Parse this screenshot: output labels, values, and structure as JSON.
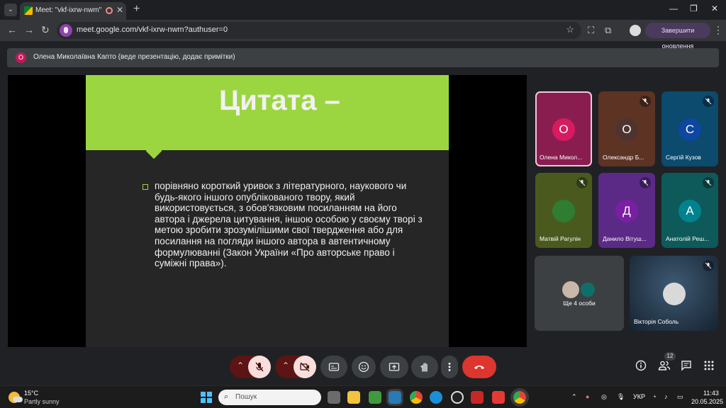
{
  "browser": {
    "tab_title": "Meet: \"vkf-ixrw-nwm\"",
    "tab_close": "✕",
    "new_tab": "+",
    "url": "meet.google.com/vkf-ixrw-nwm?authuser=0",
    "update_button": "Завершити оновлення"
  },
  "meet": {
    "presenter_initial": "О",
    "presenter_banner": "Олена Миколаївна Капто (веде презентацію, додає примітки)",
    "slide": {
      "title": "Цитата –",
      "body": "порівняно короткий уривок з літературного, наукового чи будь-якого іншого опублікованого твору, який використовується, з обов'язковим посиланням на його автора і джерела цитування, іншою особою у своєму творі з метою зробити зрозумілішими свої твердження або для посилання на погляди іншого автора в автентичному формулюванні (Закон України «Про авторське право і суміжні права»)."
    },
    "participants": [
      {
        "initial": "О",
        "name": "Олена Микол...",
        "bg": "#8a1d4f",
        "avatar_color": "#d81b60",
        "muted": false
      },
      {
        "initial": "О",
        "name": "Олександр Б...",
        "bg": "#5d3324",
        "avatar_color": "#4e342e",
        "muted": true
      },
      {
        "initial": "С",
        "name": "Сергій Кузов",
        "bg": "#0c4a6e",
        "avatar_color": "#0d47a1",
        "muted": true
      },
      {
        "initial": "",
        "name": "Матвій Рагулін",
        "bg": "#4a5a1f",
        "avatar_color": "#2e7d32",
        "muted": true
      },
      {
        "initial": "Д",
        "name": "Данило Вітуш...",
        "bg": "#5b2a86",
        "avatar_color": "#7b1fa2",
        "muted": true
      },
      {
        "initial": "А",
        "name": "Анатолій Реш...",
        "bg": "#0e5a5a",
        "avatar_color": "#00838f",
        "muted": true
      }
    ],
    "others_label": "Ще 4 особи",
    "pinned_name": "Вікторія Соболь",
    "participant_count": "12"
  },
  "taskbar": {
    "temperature": "15°C",
    "weather": "Partly sunny",
    "search_placeholder": "Пошук",
    "language": "УКР",
    "time": "11:43",
    "date": "20.05.2025"
  }
}
